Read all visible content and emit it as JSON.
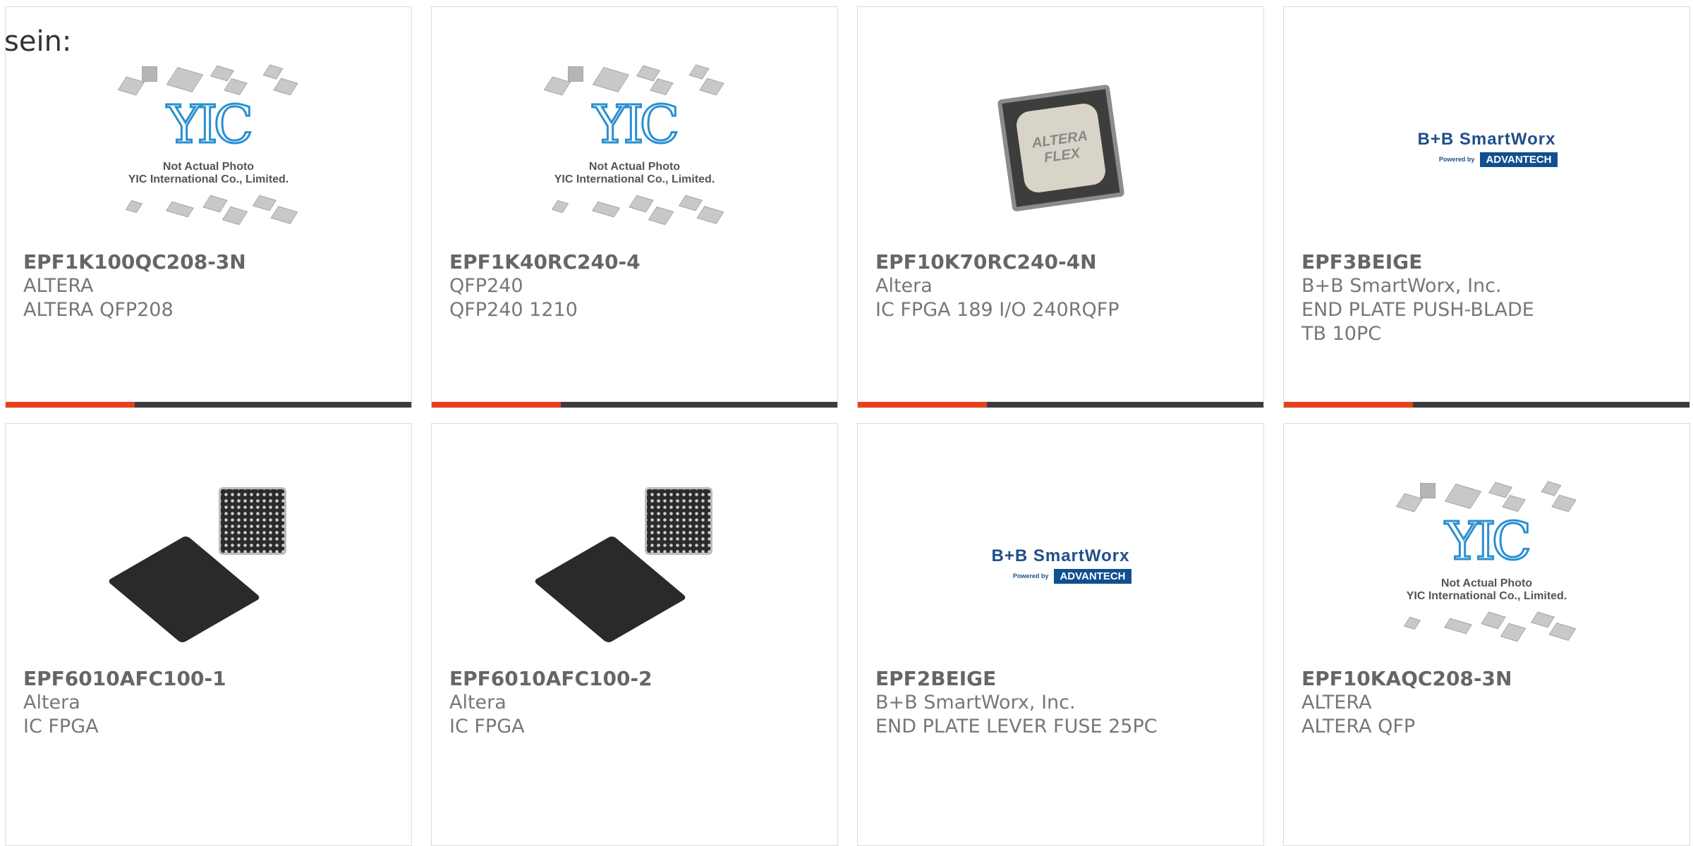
{
  "intro": {
    "text": "sein:"
  },
  "placeholder": {
    "caption_line1": "Not Actual Photo",
    "caption_line2": "YIC International Co., Limited.",
    "logo": "YIC"
  },
  "brand_logo": {
    "name": "B+B SmartWorx",
    "powered": "Powered by",
    "partner": "ADVANTECH"
  },
  "chip_label": {
    "brand": "ALTERA",
    "family": "FLEX"
  },
  "products": [
    {
      "part": "EPF1K100QC208-3N",
      "maker": "ALTERA",
      "desc": "ALTERA QFP208",
      "image": "yic-placeholder"
    },
    {
      "part": "EPF1K40RC240-4",
      "maker": "QFP240",
      "desc": "QFP240 1210",
      "image": "yic-placeholder"
    },
    {
      "part": "EPF10K70RC240-4N",
      "maker": "Altera",
      "desc": "IC FPGA 189 I/O 240RQFP",
      "image": "qfp-chip-photo"
    },
    {
      "part": "EPF3BEIGE",
      "maker": "B+B SmartWorx, Inc.",
      "desc": "END PLATE PUSH-BLADE TB 10PC",
      "image": "bb-smartworx-logo"
    },
    {
      "part": "EPF6010AFC100-1",
      "maker": "Altera",
      "desc": "IC FPGA",
      "image": "bga-chip-photo"
    },
    {
      "part": "EPF6010AFC100-2",
      "maker": "Altera",
      "desc": "IC FPGA",
      "image": "bga-chip-photo"
    },
    {
      "part": "EPF2BEIGE",
      "maker": "B+B SmartWorx, Inc.",
      "desc": "END PLATE LEVER FUSE 25PC",
      "image": "bb-smartworx-logo"
    },
    {
      "part": "EPF10KAQC208-3N",
      "maker": "ALTERA",
      "desc": "ALTERA QFP",
      "image": "yic-placeholder"
    }
  ],
  "colors": {
    "accent": "#e8401c",
    "bar": "#3c3c3c",
    "border": "#dcdcdc",
    "text": "#666666"
  }
}
